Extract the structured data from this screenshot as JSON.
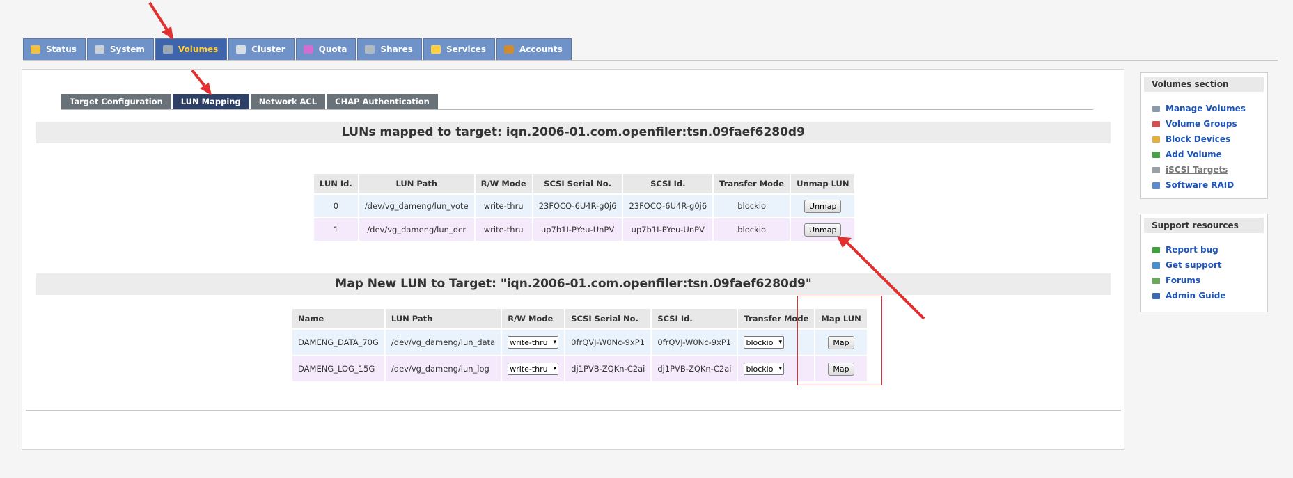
{
  "top_tabs": [
    {
      "label": "Status",
      "icon": "status-icon",
      "color": "#f0c040"
    },
    {
      "label": "System",
      "icon": "system-icon",
      "color": "#c8d0d8"
    },
    {
      "label": "Volumes",
      "icon": "volumes-icon",
      "color": "#9aa7b0",
      "active": true
    },
    {
      "label": "Cluster",
      "icon": "cluster-icon",
      "color": "#d8dde2"
    },
    {
      "label": "Quota",
      "icon": "quota-icon",
      "color": "#d46bd0"
    },
    {
      "label": "Shares",
      "icon": "shares-icon",
      "color": "#b0b8c0"
    },
    {
      "label": "Services",
      "icon": "services-icon",
      "color": "#ffd040"
    },
    {
      "label": "Accounts",
      "icon": "accounts-icon",
      "color": "#d08a30"
    }
  ],
  "sub_tabs": [
    {
      "label": "Target Configuration"
    },
    {
      "label": "LUN Mapping",
      "active": true
    },
    {
      "label": "Network ACL"
    },
    {
      "label": "CHAP Authentication"
    }
  ],
  "mapped": {
    "title": "LUNs mapped to target: iqn.2006-01.com.openfiler:tsn.09faef6280d9",
    "headers": [
      "LUN Id.",
      "LUN Path",
      "R/W Mode",
      "SCSI Serial No.",
      "SCSI Id.",
      "Transfer Mode",
      "Unmap LUN"
    ],
    "rows": [
      {
        "id": "0",
        "path": "/dev/vg_dameng/lun_vote",
        "mode": "write-thru",
        "serial": "23FOCQ-6U4R-g0j6",
        "scsi_id": "23FOCQ-6U4R-g0j6",
        "transfer": "blockio",
        "button": "Unmap"
      },
      {
        "id": "1",
        "path": "/dev/vg_dameng/lun_dcr",
        "mode": "write-thru",
        "serial": "up7b1I-PYeu-UnPV",
        "scsi_id": "up7b1I-PYeu-UnPV",
        "transfer": "blockio",
        "button": "Unmap"
      }
    ]
  },
  "new_map": {
    "title": "Map New LUN to Target: \"iqn.2006-01.com.openfiler:tsn.09faef6280d9\"",
    "headers": [
      "Name",
      "LUN Path",
      "R/W Mode",
      "SCSI Serial No.",
      "SCSI Id.",
      "Transfer Mode",
      "Map LUN"
    ],
    "rows": [
      {
        "name": "DAMENG_DATA_70G",
        "path": "/dev/vg_dameng/lun_data",
        "mode": "write-thru",
        "serial": "0frQVJ-W0Nc-9xP1",
        "scsi_id": "0frQVJ-W0Nc-9xP1",
        "transfer": "blockio",
        "button": "Map"
      },
      {
        "name": "DAMENG_LOG_15G",
        "path": "/dev/vg_dameng/lun_log",
        "mode": "write-thru",
        "serial": "dj1PVB-ZQKn-C2ai",
        "scsi_id": "dj1PVB-ZQKn-C2ai",
        "transfer": "blockio",
        "button": "Map"
      }
    ]
  },
  "sidebar": {
    "volumes": {
      "title": "Volumes section",
      "items": [
        {
          "label": "Manage Volumes",
          "icon": "manage-volumes-icon",
          "color": "#8a9aa8"
        },
        {
          "label": "Volume Groups",
          "icon": "volume-groups-icon",
          "color": "#d05050"
        },
        {
          "label": "Block Devices",
          "icon": "block-devices-icon",
          "color": "#e0b040"
        },
        {
          "label": "Add Volume",
          "icon": "add-volume-icon",
          "color": "#4aa04a"
        },
        {
          "label": "iSCSI Targets",
          "icon": "iscsi-targets-icon",
          "color": "#9aa0a6"
        },
        {
          "label": "Software RAID",
          "icon": "software-raid-icon",
          "color": "#5a8ad0"
        }
      ]
    },
    "support": {
      "title": "Support resources",
      "items": [
        {
          "label": "Report bug",
          "icon": "bug-icon",
          "color": "#40a040"
        },
        {
          "label": "Get support",
          "icon": "support-icon",
          "color": "#4a90d0"
        },
        {
          "label": "Forums",
          "icon": "forums-icon",
          "color": "#6aa860"
        },
        {
          "label": "Admin Guide",
          "icon": "guide-icon",
          "color": "#3a6ab0"
        }
      ]
    }
  },
  "annotation_color": "#e23030"
}
